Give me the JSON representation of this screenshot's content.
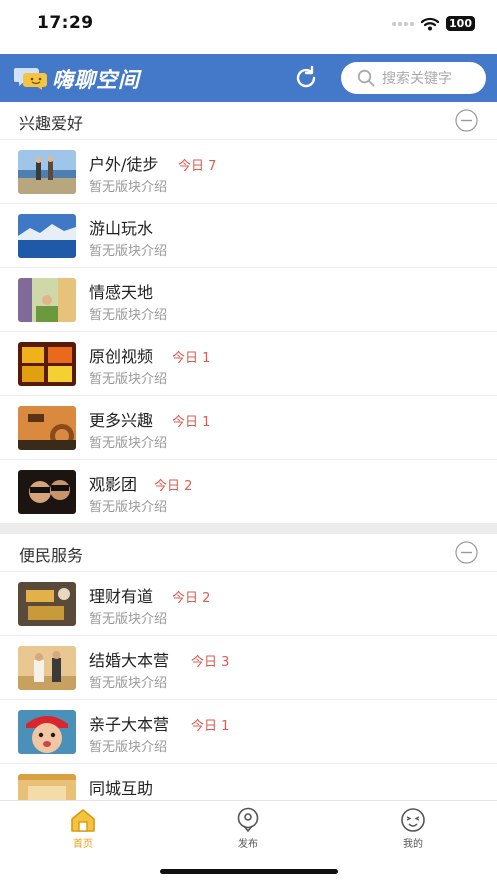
{
  "status_bar": {
    "time": "17:29",
    "battery": "100"
  },
  "header": {
    "app_name": "嗨聊空间",
    "search_placeholder": "搜索关键字"
  },
  "sections": [
    {
      "title": "兴趣爱好",
      "items": [
        {
          "title": "户外/徒步",
          "today": "今日 7",
          "desc": "暂无版块介绍"
        },
        {
          "title": "游山玩水",
          "today": "",
          "desc": "暂无版块介绍"
        },
        {
          "title": "情感天地",
          "today": "",
          "desc": "暂无版块介绍"
        },
        {
          "title": "原创视频",
          "today": "今日 1",
          "desc": "暂无版块介绍"
        },
        {
          "title": "更多兴趣",
          "today": "今日 1",
          "desc": "暂无版块介绍"
        },
        {
          "title": "观影团",
          "today": "今日 2",
          "desc": "暂无版块介绍"
        }
      ]
    },
    {
      "title": "便民服务",
      "items": [
        {
          "title": "理财有道",
          "today": "今日 2",
          "desc": "暂无版块介绍"
        },
        {
          "title": "结婚大本营",
          "today": "今日 3",
          "desc": "暂无版块介绍"
        },
        {
          "title": "亲子大本营",
          "today": "今日 1",
          "desc": "暂无版块介绍"
        },
        {
          "title": "同城互助",
          "today": "",
          "desc": ""
        }
      ]
    }
  ],
  "tabbar": {
    "home": "首页",
    "publish": "发布",
    "mine": "我的"
  },
  "colors": {
    "header_bg": "#4478c8",
    "today": "#e05a4f",
    "tab_active": "#e8a317"
  },
  "icons": [
    "refresh-icon",
    "search-icon",
    "collapse-icon",
    "home-icon",
    "publish-icon",
    "profile-icon",
    "wifi-icon"
  ]
}
